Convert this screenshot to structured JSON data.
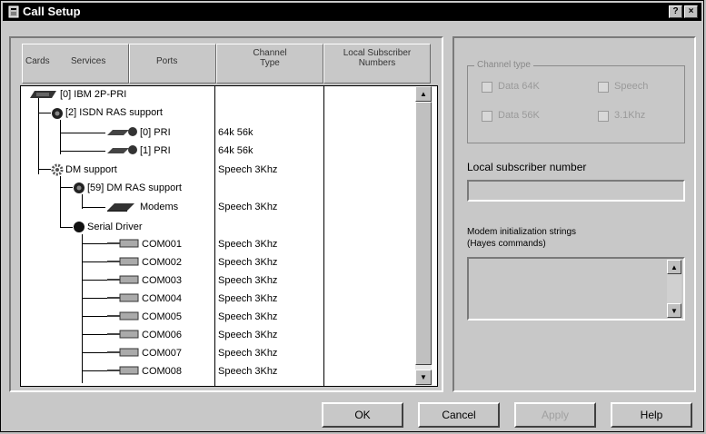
{
  "window": {
    "title": "Call Setup",
    "help_btn": "?",
    "close_btn": "×"
  },
  "columns": {
    "cards": "Cards",
    "services": "Services",
    "ports": "Ports",
    "channel_type": [
      "Channel",
      "Type"
    ],
    "local_subscriber": [
      "Local Subscriber",
      "Numbers"
    ]
  },
  "tree": [
    {
      "label": "[0] IBM 2P-PRI",
      "type": ""
    },
    {
      "label": "[2] ISDN RAS support",
      "type": ""
    },
    {
      "label": "[0] PRI",
      "type": "64k 56k"
    },
    {
      "label": "[1] PRI",
      "type": "64k 56k"
    },
    {
      "label": "DM support",
      "type": "Speech 3Khz"
    },
    {
      "label": "[59] DM RAS support",
      "type": ""
    },
    {
      "label": "Modems",
      "type": "Speech 3Khz"
    },
    {
      "label": "Serial Driver",
      "type": ""
    },
    {
      "label": "COM001",
      "type": "Speech 3Khz"
    },
    {
      "label": "COM002",
      "type": "Speech 3Khz"
    },
    {
      "label": "COM003",
      "type": "Speech 3Khz"
    },
    {
      "label": "COM004",
      "type": "Speech 3Khz"
    },
    {
      "label": "COM005",
      "type": "Speech 3Khz"
    },
    {
      "label": "COM006",
      "type": "Speech 3Khz"
    },
    {
      "label": "COM007",
      "type": "Speech 3Khz"
    },
    {
      "label": "COM008",
      "type": "Speech 3Khz"
    }
  ],
  "channel_group": {
    "title": "Channel type",
    "data64k": "Data 64K",
    "speech": "Speech",
    "data56k": "Data 56K",
    "khz": "3.1Khz"
  },
  "local_subscriber_label": "Local subscriber number",
  "local_subscriber_value": "",
  "modem_init_label": [
    "Modem initialization strings",
    "(Hayes commands)"
  ],
  "modem_init_value": "",
  "buttons": {
    "ok": "OK",
    "cancel": "Cancel",
    "apply": "Apply",
    "help": "Help"
  }
}
